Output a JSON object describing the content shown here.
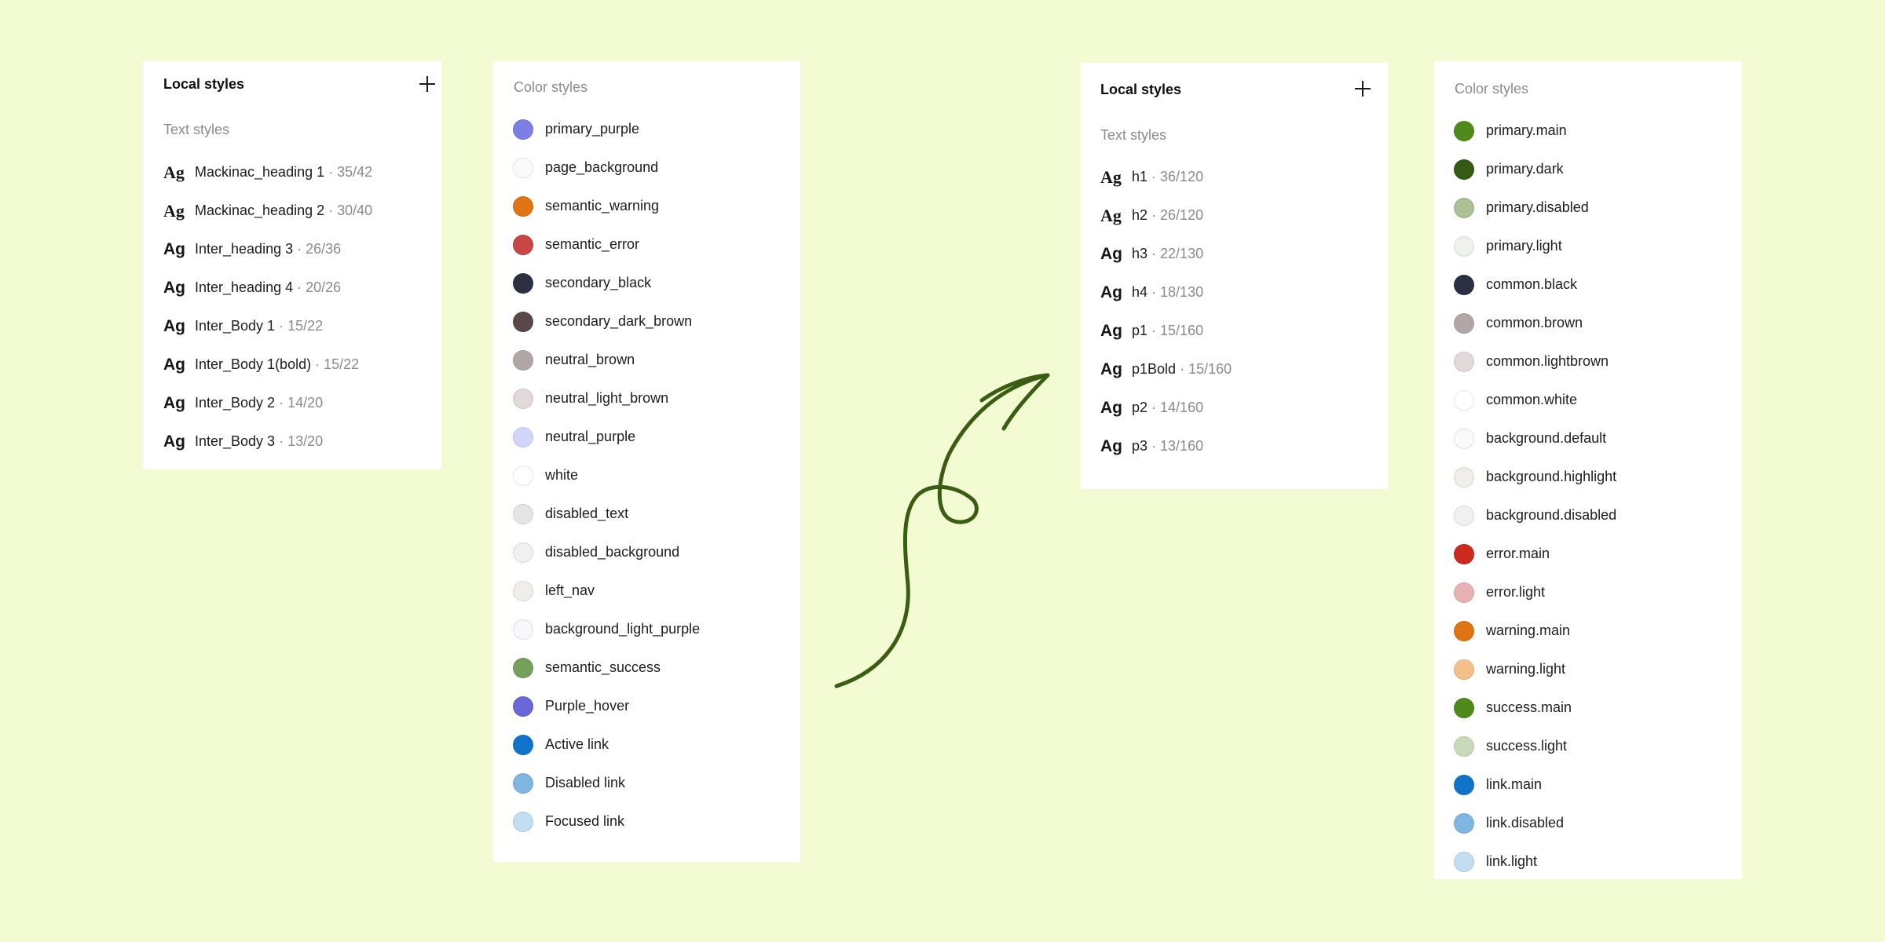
{
  "panel_left_text": {
    "header": "Local styles",
    "section": "Text styles",
    "items": [
      {
        "ag": "Ag",
        "name": "Mackinac_heading 1",
        "sep": "·",
        "size": "35/42",
        "serif": true
      },
      {
        "ag": "Ag",
        "name": "Mackinac_heading 2",
        "sep": "·",
        "size": "30/40",
        "serif": true
      },
      {
        "ag": "Ag",
        "name": "Inter_heading 3",
        "sep": "·",
        "size": "26/36",
        "serif": false
      },
      {
        "ag": "Ag",
        "name": "Inter_heading 4",
        "sep": "·",
        "size": "20/26",
        "serif": false
      },
      {
        "ag": "Ag",
        "name": "Inter_Body 1",
        "sep": "·",
        "size": "15/22",
        "serif": false
      },
      {
        "ag": "Ag",
        "name": "Inter_Body 1(bold)",
        "sep": "·",
        "size": "15/22",
        "serif": false
      },
      {
        "ag": "Ag",
        "name": "Inter_Body 2",
        "sep": "·",
        "size": "14/20",
        "serif": false
      },
      {
        "ag": "Ag",
        "name": "Inter_Body 3",
        "sep": "·",
        "size": "13/20",
        "serif": false
      }
    ]
  },
  "panel_left_colors": {
    "section": "Color styles",
    "items": [
      {
        "name": "primary_purple",
        "color": "#7b7fe6"
      },
      {
        "name": "page_background",
        "color": "#fafafa"
      },
      {
        "name": "semantic_warning",
        "color": "#e07414"
      },
      {
        "name": "semantic_error",
        "color": "#c84646"
      },
      {
        "name": "secondary_black",
        "color": "#2b3042"
      },
      {
        "name": "secondary_dark_brown",
        "color": "#594847"
      },
      {
        "name": "neutral_brown",
        "color": "#b2a7a7"
      },
      {
        "name": "neutral_light_brown",
        "color": "#e2dada"
      },
      {
        "name": "neutral_purple",
        "color": "#d3d6fb"
      },
      {
        "name": "white",
        "color": "#ffffff"
      },
      {
        "name": "disabled_text",
        "color": "#e5e5e5"
      },
      {
        "name": "disabled_background",
        "color": "#f0f0f0"
      },
      {
        "name": "left_nav",
        "color": "#efeee9"
      },
      {
        "name": "background_light_purple",
        "color": "#f7f7fd"
      },
      {
        "name": "semantic_success",
        "color": "#76a05a"
      },
      {
        "name": "Purple_hover",
        "color": "#6968d8"
      },
      {
        "name": "Active link",
        "color": "#1273cc"
      },
      {
        "name": "Disabled link",
        "color": "#80b6e2"
      },
      {
        "name": "Focused link",
        "color": "#c3def3"
      }
    ]
  },
  "panel_right_text": {
    "header": "Local styles",
    "section": "Text styles",
    "items": [
      {
        "ag": "Ag",
        "name": "h1",
        "sep": "·",
        "size": "36/120",
        "serif": true
      },
      {
        "ag": "Ag",
        "name": "h2",
        "sep": "·",
        "size": "26/120",
        "serif": true
      },
      {
        "ag": "Ag",
        "name": "h3",
        "sep": "·",
        "size": "22/130",
        "serif": false
      },
      {
        "ag": "Ag",
        "name": "h4",
        "sep": "·",
        "size": "18/130",
        "serif": false
      },
      {
        "ag": "Ag",
        "name": "p1",
        "sep": "·",
        "size": "15/160",
        "serif": false
      },
      {
        "ag": "Ag",
        "name": "p1Bold",
        "sep": "·",
        "size": "15/160",
        "serif": false
      },
      {
        "ag": "Ag",
        "name": "p2",
        "sep": "·",
        "size": "14/160",
        "serif": false
      },
      {
        "ag": "Ag",
        "name": "p3",
        "sep": "·",
        "size": "13/160",
        "serif": false
      }
    ]
  },
  "panel_right_colors": {
    "section": "Color styles",
    "items": [
      {
        "name": "primary.main",
        "color": "#4e8a1c"
      },
      {
        "name": "primary.dark",
        "color": "#345a14"
      },
      {
        "name": "primary.disabled",
        "color": "#a9c195"
      },
      {
        "name": "primary.light",
        "color": "#eef2e8"
      },
      {
        "name": "common.black",
        "color": "#2b3042"
      },
      {
        "name": "common.brown",
        "color": "#b2a7a7"
      },
      {
        "name": "common.lightbrown",
        "color": "#e2dada"
      },
      {
        "name": "common.white",
        "color": "#ffffff"
      },
      {
        "name": "background.default",
        "color": "#fafafa"
      },
      {
        "name": "background.highlight",
        "color": "#efeee9"
      },
      {
        "name": "background.disabled",
        "color": "#f0f0f0"
      },
      {
        "name": "error.main",
        "color": "#cc2a1e"
      },
      {
        "name": "error.light",
        "color": "#e8b2b2"
      },
      {
        "name": "warning.main",
        "color": "#e07414"
      },
      {
        "name": "warning.light",
        "color": "#f6c08c"
      },
      {
        "name": "success.main",
        "color": "#4e8a1c"
      },
      {
        "name": "success.light",
        "color": "#c8dab9"
      },
      {
        "name": "link.main",
        "color": "#1273cc"
      },
      {
        "name": "link.disabled",
        "color": "#80b6e2"
      },
      {
        "name": "link.light",
        "color": "#c3def3"
      }
    ]
  },
  "arrow": {
    "color": "#3b5d13"
  }
}
